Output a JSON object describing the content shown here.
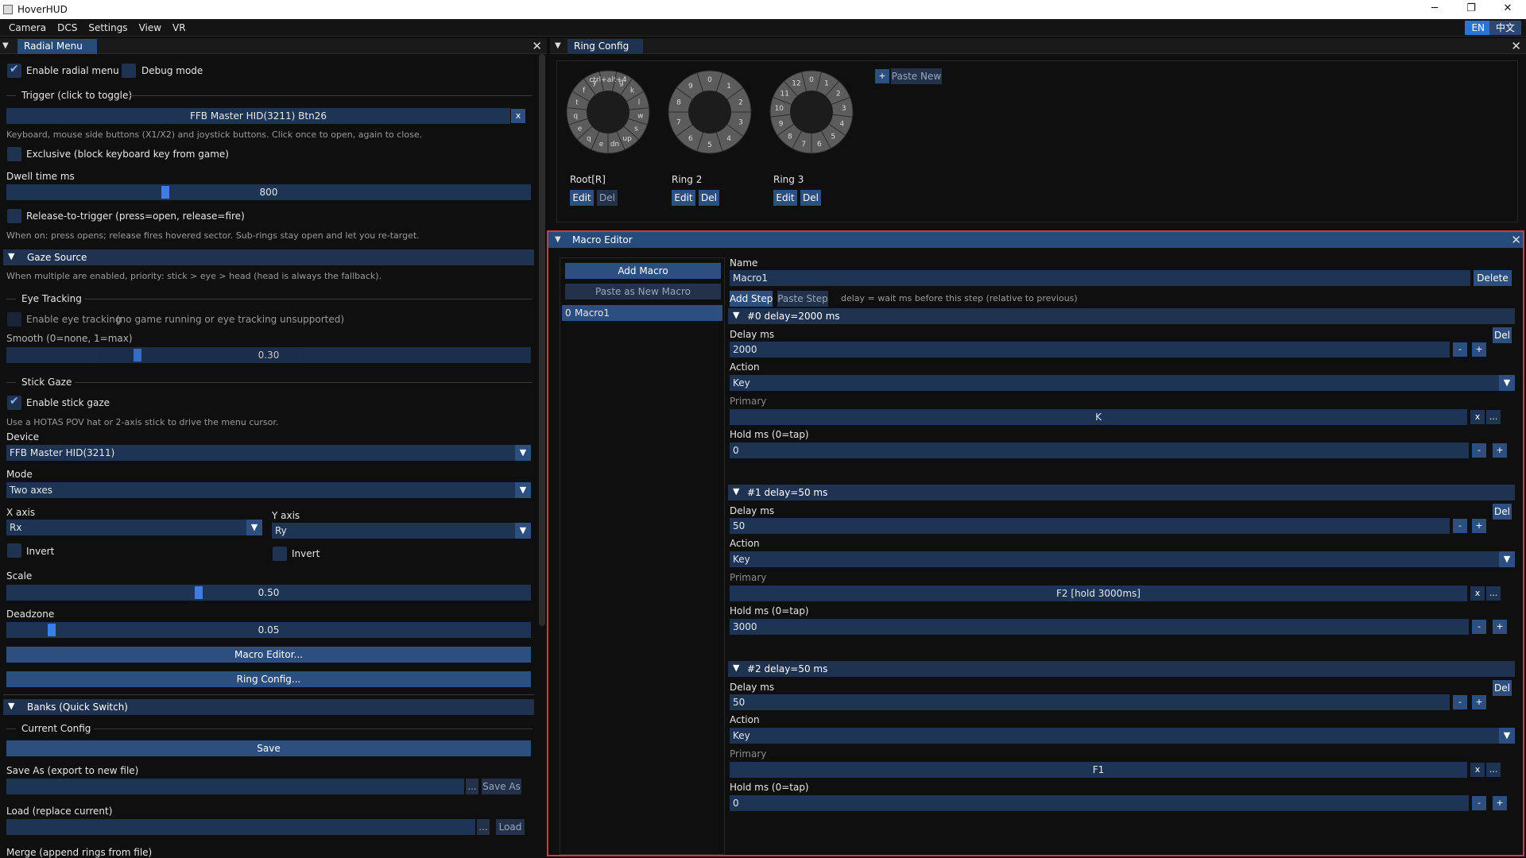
{
  "window": {
    "title": "HoverHUD",
    "minimize": "─",
    "restore": "❐",
    "close": "✕"
  },
  "menubar": {
    "items": [
      "Camera",
      "DCS",
      "Settings",
      "View",
      "VR"
    ],
    "lang_en": "EN",
    "lang_zh": "中文"
  },
  "radial": {
    "tab": "Radial Menu",
    "enable_radial": "Enable radial menu",
    "debug_mode": "Debug mode",
    "trigger_section": "Trigger (click to toggle)",
    "trigger_value": "FFB Master HID(3211) Btn26",
    "trigger_clear": "x",
    "trigger_hint": "Keyboard, mouse side buttons (X1/X2) and joystick buttons. Click once to open, again to close.",
    "exclusive": "Exclusive (block keyboard key from game)",
    "dwell_label": "Dwell time ms",
    "dwell_value": "800",
    "dwell_level": 0.5,
    "release_trigger": "Release-to-trigger (press=open, release=fire)",
    "release_hint": "When on: press opens; release fires hovered sector. Sub-rings stay open and let you re-target.",
    "gaze_header": "Gaze Source",
    "gaze_hint": "When multiple are enabled, priority: stick > eye > head (head is always the fallback).",
    "eye_section": "Eye Tracking",
    "enable_eye": "Enable eye tracking",
    "eye_status": "(no game running or eye tracking unsupported)",
    "smooth_label": "Smooth (0=none, 1=max)",
    "smooth_value": "0.30",
    "smooth_level": 0.3,
    "stick_section": "Stick Gaze",
    "enable_stick": "Enable stick gaze",
    "stick_hint": "Use a HOTAS POV hat or 2-axis stick to drive the menu cursor.",
    "device_label": "Device",
    "device_value": "FFB Master HID(3211)",
    "mode_label": "Mode",
    "mode_value": "Two axes",
    "x_axis_label": "X axis",
    "x_axis_value": "Rx",
    "y_axis_label": "Y axis",
    "y_axis_value": "Ry",
    "invert_x": "Invert",
    "invert_y": "Invert",
    "scale_label": "Scale",
    "scale_value": "0.50",
    "scale_level": 0.5,
    "deadzone_label": "Deadzone",
    "deadzone_value": "0.05",
    "deadzone_level": 0.05,
    "macro_editor_btn": "Macro Editor...",
    "ring_config_btn": "Ring Config...",
    "banks_header": "Banks (Quick Switch)",
    "current_config": "Current Config",
    "save_btn": "Save",
    "save_as_label": "Save As (export to new file)",
    "browse": "...",
    "save_as_btn": "Save As",
    "load_label": "Load (replace current)",
    "load_btn": "Load",
    "merge_label": "Merge (append rings from file)"
  },
  "ring_config": {
    "tab": "Ring Config",
    "paste_plus": "+",
    "paste_new": "Paste New",
    "rings": [
      {
        "name": "Root[R]",
        "edit": "Edit",
        "del": "Del",
        "labels": [
          "ctrl+alt+4",
          "g",
          "k",
          "l",
          "w",
          "s",
          "up",
          "dn",
          "e",
          "q",
          "e",
          "q",
          "t",
          "f",
          "y"
        ]
      },
      {
        "name": "Ring 2",
        "edit": "Edit",
        "del": "Del",
        "labels": [
          "0",
          "1",
          "2",
          "3",
          "4",
          "5",
          "6",
          "7",
          "8",
          "9"
        ]
      },
      {
        "name": "Ring 3",
        "edit": "Edit",
        "del": "Del",
        "labels": [
          "0",
          "1",
          "2",
          "3",
          "4",
          "5",
          "6",
          "7",
          "8",
          "9",
          "10",
          "11",
          "12"
        ]
      }
    ]
  },
  "macro_editor": {
    "tab": "Macro Editor",
    "add_macro": "Add Macro",
    "paste_new_macro": "Paste as New Macro",
    "macros": [
      {
        "index": "0",
        "name": "Macro1"
      }
    ],
    "name_label": "Name",
    "name_value": "Macro1",
    "delete": "Delete",
    "add_step": "Add Step",
    "paste_step": "Paste Step",
    "step_hint": "delay = wait ms before this step (relative to previous)",
    "labels": {
      "delay": "Delay ms",
      "action": "Action",
      "primary": "Primary",
      "hold": "Hold ms (0=tap)",
      "del": "Del",
      "minus": "-",
      "plus": "+",
      "clear": "x",
      "browse": "..."
    },
    "steps": [
      {
        "header": "#0  delay=2000 ms",
        "delay": "2000",
        "action": "Key",
        "primary": "K",
        "hold": "0"
      },
      {
        "header": "#1  delay=50 ms",
        "delay": "50",
        "action": "Key",
        "primary": "F2 [hold 3000ms]",
        "hold": "3000"
      },
      {
        "header": "#2  delay=50 ms",
        "delay": "50",
        "action": "Key",
        "primary": "F1",
        "hold": "0"
      }
    ]
  },
  "colors": {
    "accent": "#2b74d6",
    "frame": "#1d3455",
    "button": "#2c4f7f",
    "highlight_border": "#e03535"
  }
}
